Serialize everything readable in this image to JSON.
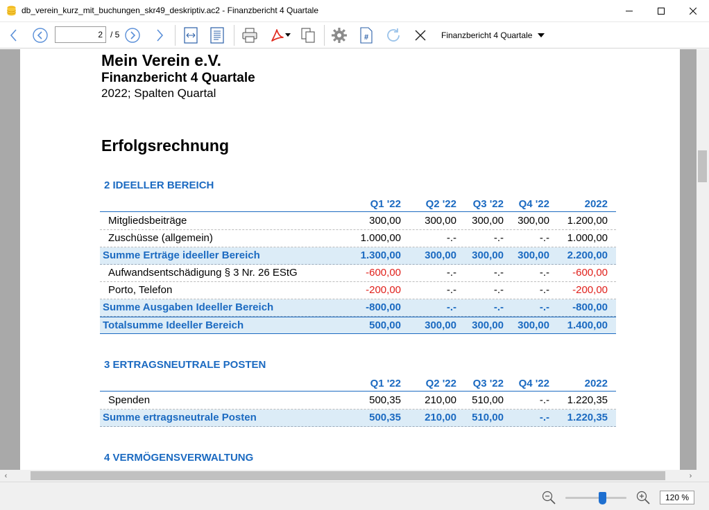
{
  "window": {
    "title": "db_verein_kurz_mit_buchungen_skr49_deskriptiv.ac2 - Finanzbericht 4 Quartale"
  },
  "toolbar": {
    "page_current": "2",
    "page_total": "/ 5",
    "report_selector": "Finanzbericht 4 Quartale"
  },
  "document": {
    "org_name": "Mein Verein e.V.",
    "report_title": "Finanzbericht 4 Quartale",
    "report_subtitle": "2022; Spalten Quartal",
    "section_title": "Erfolgsrechnung",
    "columns": [
      "Q1 '22",
      "Q2 '22",
      "Q3 '22",
      "Q4 '22",
      "2022"
    ],
    "groups": [
      {
        "title": "2 IDEELLER BEREICH",
        "rows": [
          {
            "type": "item",
            "label": "Mitgliedsbeiträge",
            "values": [
              "300,00",
              "300,00",
              "300,00",
              "300,00",
              "1.200,00"
            ]
          },
          {
            "type": "item",
            "label": "Zuschüsse (allgemein)",
            "values": [
              "1.000,00",
              "-.-",
              "-.-",
              "-.-",
              "1.000,00"
            ]
          },
          {
            "type": "sum",
            "label": "Summe Erträge ideeller Bereich",
            "values": [
              "1.300,00",
              "300,00",
              "300,00",
              "300,00",
              "2.200,00"
            ]
          },
          {
            "type": "item",
            "label": "Aufwandsentschädigung § 3 Nr. 26 EStG",
            "values": [
              "-600,00",
              "-.-",
              "-.-",
              "-.-",
              "-600,00"
            ]
          },
          {
            "type": "item",
            "label": "Porto, Telefon",
            "values": [
              "-200,00",
              "-.-",
              "-.-",
              "-.-",
              "-200,00"
            ]
          },
          {
            "type": "sum",
            "label": "Summe Ausgaben Ideeller Bereich",
            "values": [
              "-800,00",
              "-.-",
              "-.-",
              "-.-",
              "-800,00"
            ]
          },
          {
            "type": "total",
            "label": "Totalsumme Ideeller Bereich",
            "values": [
              "500,00",
              "300,00",
              "300,00",
              "300,00",
              "1.400,00"
            ]
          }
        ]
      },
      {
        "title": "3 ERTRAGSNEUTRALE POSTEN",
        "rows": [
          {
            "type": "item",
            "label": "Spenden",
            "values": [
              "500,35",
              "210,00",
              "510,00",
              "-.-",
              "1.220,35"
            ]
          },
          {
            "type": "sum",
            "label": "Summe ertragsneutrale Posten",
            "values": [
              "500,35",
              "210,00",
              "510,00",
              "-.-",
              "1.220,35"
            ]
          }
        ]
      },
      {
        "title": "4 VERMÖGENSVERWALTUNG",
        "rows": []
      }
    ]
  },
  "statusbar": {
    "zoom_value": "120 %",
    "zoom_level": 0.6
  },
  "colors": {
    "accent": "#1b6ac1",
    "negative": "#e0201b",
    "sum_row_bg": "#dcecf7"
  }
}
